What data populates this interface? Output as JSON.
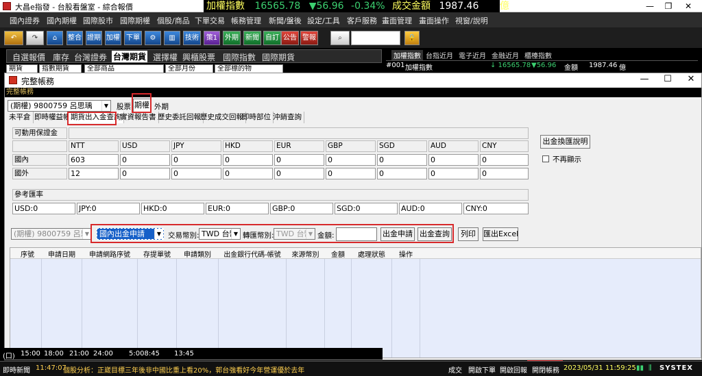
{
  "app": {
    "title": "大昌e指發 - 台股看盤室 - 綜合報價",
    "window_controls": [
      "—",
      "❐",
      "✕"
    ]
  },
  "ticker": {
    "name": "加權指數",
    "value": "16565.78",
    "change": "▼56.96",
    "change_pct": "-0.34%",
    "volume_label": "成交金額",
    "volume": "1987.46",
    "unit": "億"
  },
  "menu": [
    "國內證券",
    "國內期權",
    "國際股市",
    "國際期權",
    "個股/商品",
    "下單交易",
    "帳務管理",
    "新聞/盤後",
    "設定/工具",
    "客戶服務",
    "畫面管理",
    "畫面操作",
    "視窗/說明"
  ],
  "toolbar": [
    "整合",
    "證期",
    "加權",
    "下單",
    "⚙",
    "",
    "技術",
    "策1",
    "外期",
    "新聞",
    "自訂",
    "公告",
    "警報"
  ],
  "left_tabs": [
    "自選報價",
    "庫存",
    "台灣證券",
    "台灣期貨",
    "選擇權",
    "興櫃股票",
    "國際指數",
    "國際期貨"
  ],
  "left_tabs_selected": 3,
  "left_filters": [
    "期貨",
    "指數期貨",
    "全部商品",
    "全部月份",
    "全部標的物"
  ],
  "right_tabs": [
    "加權指數",
    "台指近月",
    "電子近月",
    "金融近月",
    "櫃檯指數"
  ],
  "right_tabs_selected": 0,
  "right_row": {
    "code": "#001",
    "name": "加權指數",
    "value": "↓ 16565.78",
    "change": "▼56.96",
    "vol_label": "金額",
    "vol": "1987.46",
    "unit": "億"
  },
  "dialog": {
    "title": "完整帳務",
    "controls": [
      "—",
      "☐",
      "✕"
    ],
    "panel_header": "完整帳務",
    "account_select": "(期權) 9800759 呂思瑀",
    "market_buttons": [
      "股票",
      "期權",
      "外期"
    ],
    "market_selected": 1,
    "tabs": [
      "未平倉",
      "即時權益帳",
      "期貨出入金查詢",
      "實資報告書",
      "歷史委託回報",
      "歷史成交回報",
      "即時部位",
      "沖銷查詢"
    ],
    "tab_selected": 2,
    "deposit": {
      "label": "可動用保證金",
      "currencies": [
        "NTT",
        "USD",
        "JPY",
        "HKD",
        "EUR",
        "GBP",
        "SGD",
        "AUD",
        "CNY"
      ],
      "rows": [
        {
          "label": "國內",
          "values": [
            "603",
            "0",
            "0",
            "0",
            "0",
            "0",
            "0",
            "0",
            "0"
          ]
        },
        {
          "label": "國外",
          "values": [
            "12",
            "0",
            "0",
            "0",
            "0",
            "0",
            "0",
            "0",
            "0"
          ]
        }
      ]
    },
    "rates": {
      "label": "參考匯率",
      "values": [
        "USD:0",
        "JPY:0",
        "HKD:0",
        "EUR:0",
        "GBP:0",
        "SGD:0",
        "AUD:0",
        "CNY:0"
      ]
    },
    "side_button": "出金換匯說明",
    "side_checkbox": "不再顯示",
    "request": {
      "account": "(期權) 9800759 呂思瑀",
      "type": "國內出金申請",
      "trade_currency_label": "交易幣別:",
      "trade_currency": "TWD 台幣",
      "convert_currency_label": "轉匯幣別:",
      "convert_currency": "TWD 台幣",
      "amount_label": "金額:",
      "amount": "",
      "buttons": [
        "出金申請",
        "出金查詢",
        "列印",
        "匯出Excel"
      ]
    },
    "grid_headers": [
      "序號",
      "申請日期",
      "申請網路序號",
      "存提單號",
      "申請類別",
      "出金銀行代碼-帳號",
      "來源幣別",
      "金額",
      "處理狀態",
      "操作"
    ]
  },
  "timebar": {
    "label": "(口)",
    "times": [
      "15:00",
      "18:00",
      "21:00",
      "24:00"
    ],
    "clock": "5:008:45",
    "right": "13:45"
  },
  "status": {
    "news_label": "即時新聞",
    "news_time": "11:47:07",
    "news_text": "個股分析：正崴目標三年後非中國比重上看20%，郭台強看好今年營運優於去年",
    "items": [
      "成交",
      "開啟下單",
      "開啟回報",
      "開閉帳務"
    ],
    "datetime": "2023/05/31 11:59:25",
    "brand": "SYSTEX",
    "colors": {
      "accent": "#d7282a",
      "up": "#3cd070",
      "down": "#3cd070",
      "highlight": "#ffff60"
    }
  }
}
